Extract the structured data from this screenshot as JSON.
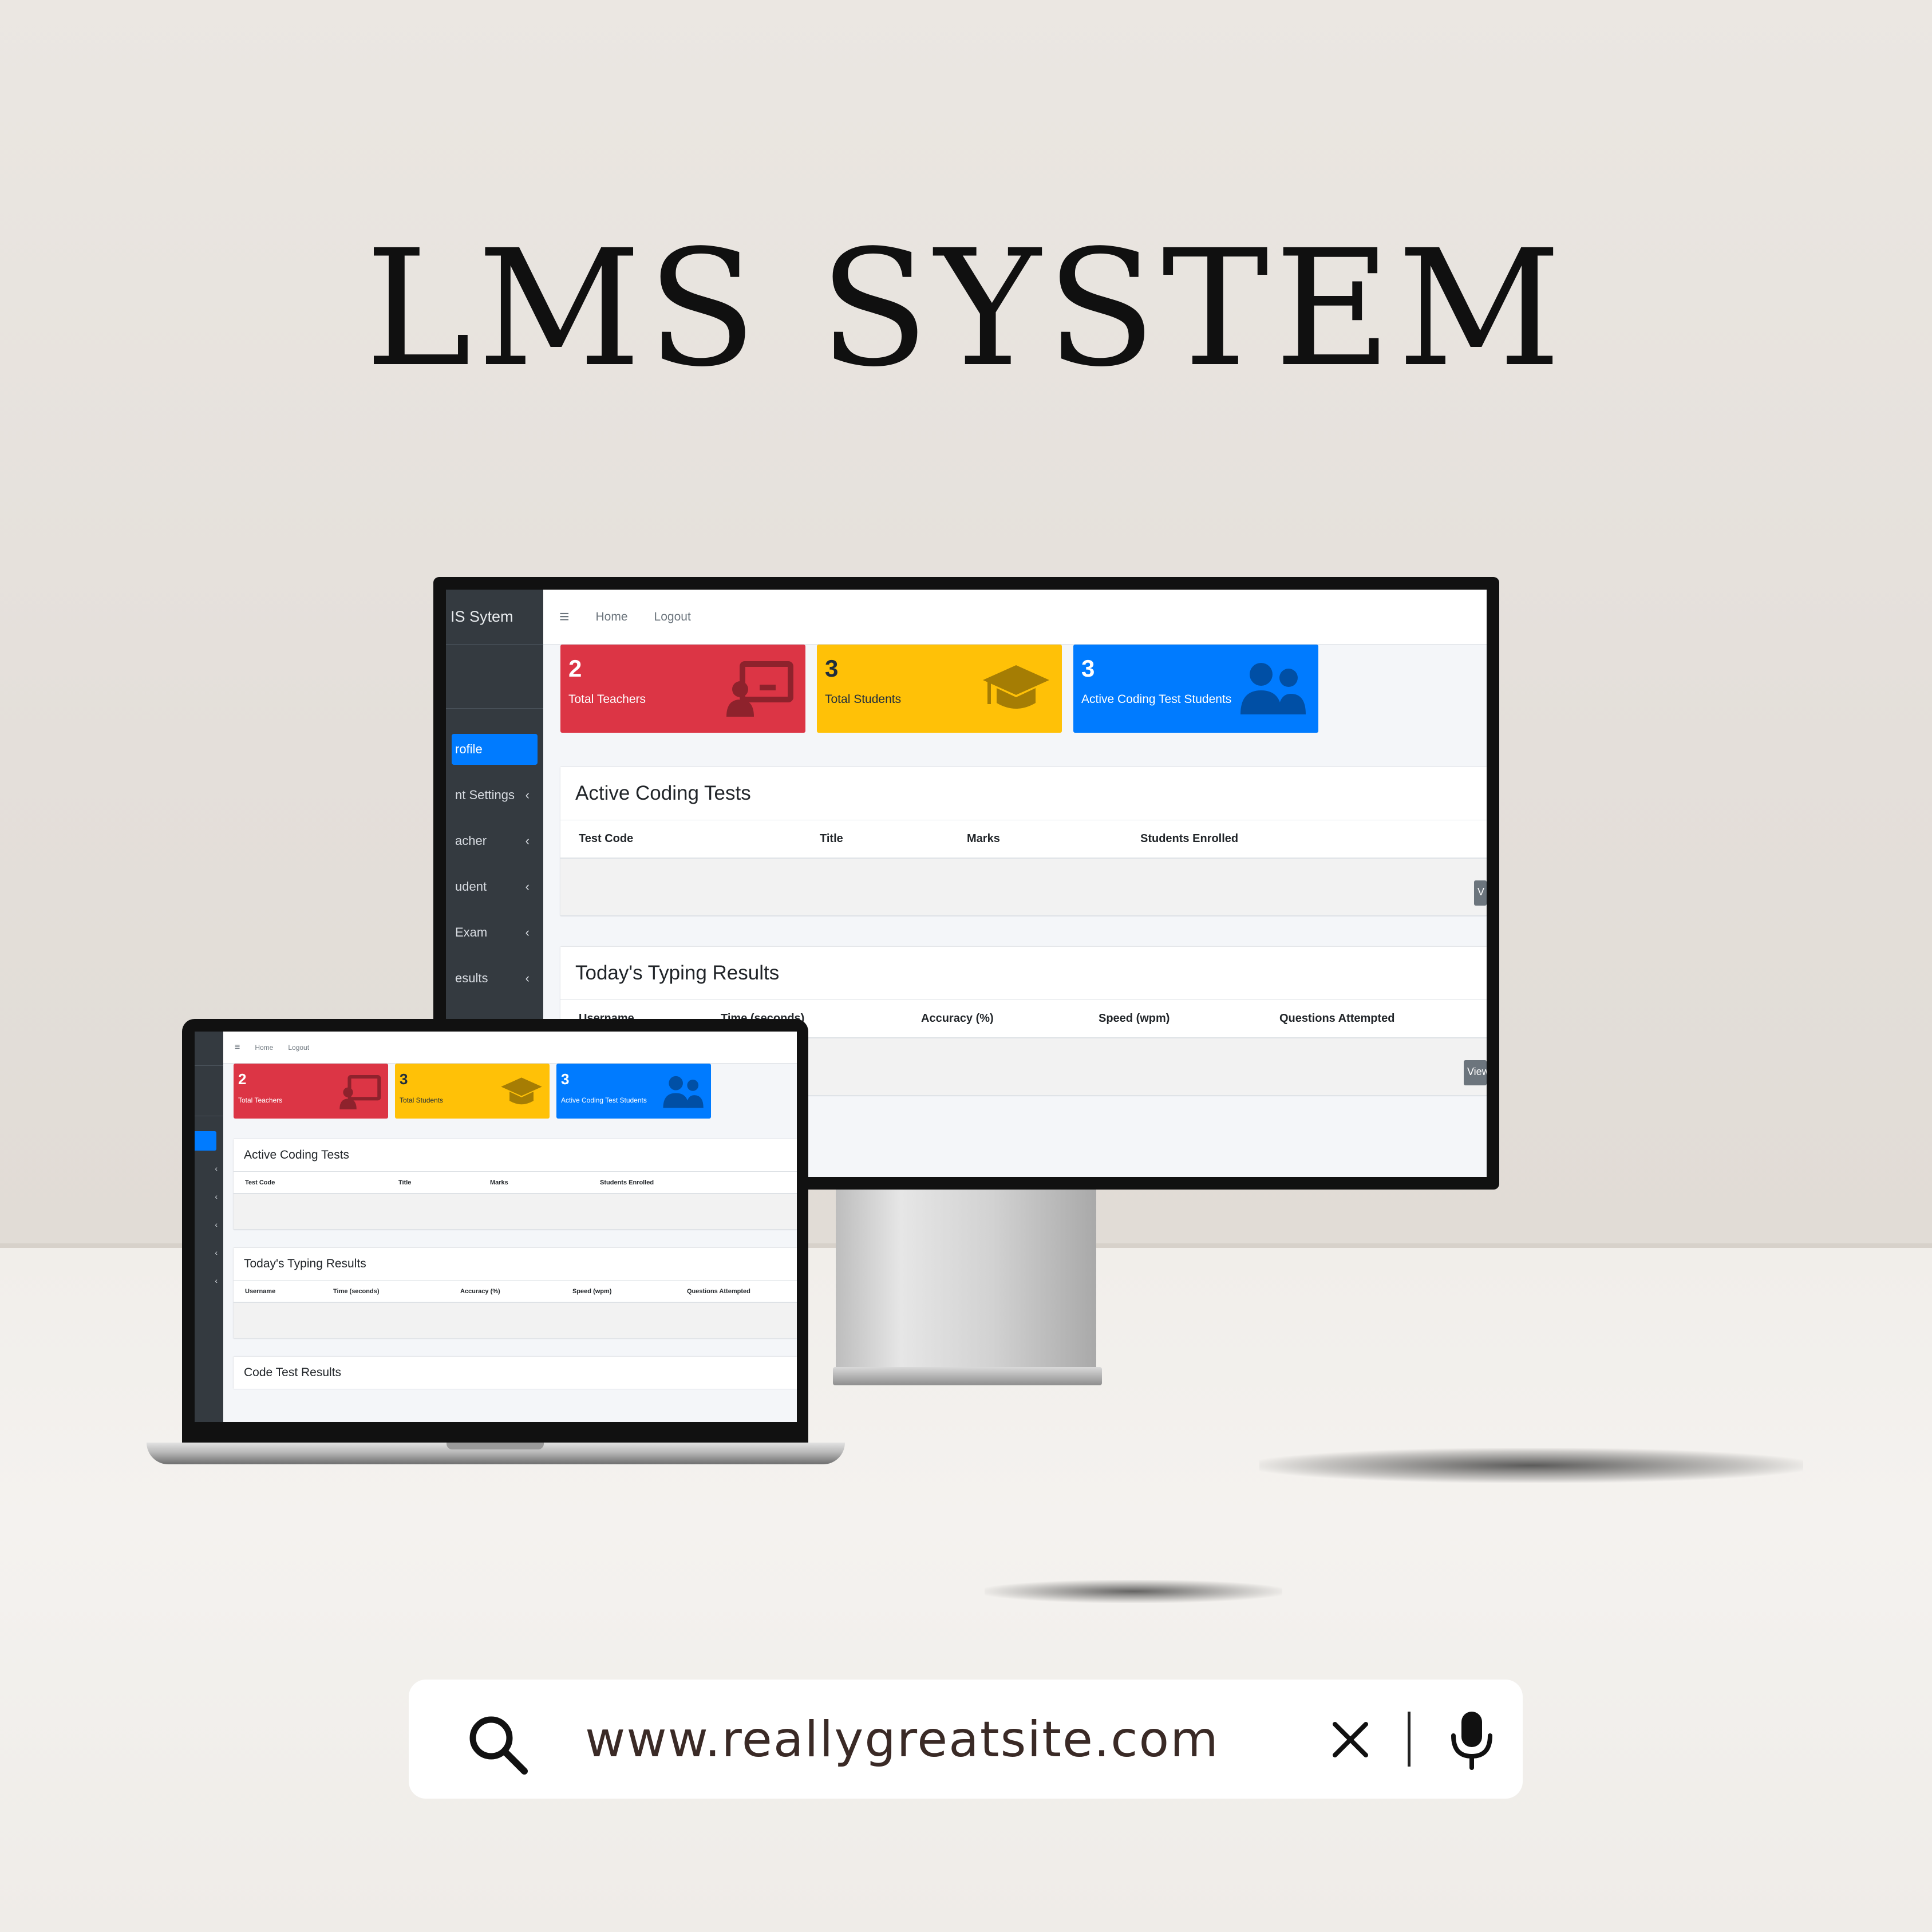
{
  "headline": "LMS SYSTEM",
  "colors": {
    "sidebar_bg": "#343a40",
    "active_blue": "#007bff",
    "box_red": "#dc3545",
    "box_yellow": "#ffc107",
    "box_blue": "#007bff"
  },
  "monitor": {
    "brand": "IS Sytem",
    "sidebar_items": [
      {
        "label": "rofile",
        "chevron": ""
      },
      {
        "label": "nt Settings",
        "chevron": "‹"
      },
      {
        "label": "acher",
        "chevron": "‹"
      },
      {
        "label": "udent",
        "chevron": "‹"
      },
      {
        "label": "Exam",
        "chevron": "‹"
      },
      {
        "label": "esults",
        "chevron": "‹"
      }
    ],
    "nav": {
      "menu_icon": "≡",
      "home": "Home",
      "logout": "Logout"
    },
    "boxes": [
      {
        "value": "2",
        "label": "Total Teachers",
        "icon": "teacher-board-icon"
      },
      {
        "value": "3",
        "label": "Total Students",
        "icon": "graduation-cap-icon"
      },
      {
        "value": "3",
        "label": "Active Coding Test Students",
        "icon": "users-icon"
      }
    ],
    "coding_tests": {
      "title": "Active Coding Tests",
      "columns": [
        "Test Code",
        "Title",
        "Marks",
        "Students Enrolled"
      ],
      "button": "V"
    },
    "typing_results": {
      "title": "Today's Typing Results",
      "columns": [
        "Username",
        "Time (seconds)",
        "Accuracy (%)",
        "Speed (wpm)",
        "Questions Attempted"
      ],
      "button": "View"
    }
  },
  "laptop": {
    "sidebar_chevrons": [
      "‹",
      "‹",
      "‹",
      "‹",
      "‹"
    ],
    "nav": {
      "menu_icon": "≡",
      "home": "Home",
      "logout": "Logout"
    },
    "boxes": [
      {
        "value": "2",
        "label": "Total Teachers"
      },
      {
        "value": "3",
        "label": "Total Students"
      },
      {
        "value": "3",
        "label": "Active Coding Test Students"
      }
    ],
    "coding_tests": {
      "title": "Active Coding Tests",
      "columns": [
        "Test Code",
        "Title",
        "Marks",
        "Students Enrolled"
      ]
    },
    "typing_results": {
      "title": "Today's Typing Results",
      "columns": [
        "Username",
        "Time (seconds)",
        "Accuracy (%)",
        "Speed (wpm)",
        "Questions Attempted"
      ]
    },
    "code_results": {
      "title": "Code Test Results"
    }
  },
  "search": {
    "url": "www.reallygreatsite.com",
    "icons": [
      "search-icon",
      "close-icon",
      "microphone-icon"
    ]
  }
}
